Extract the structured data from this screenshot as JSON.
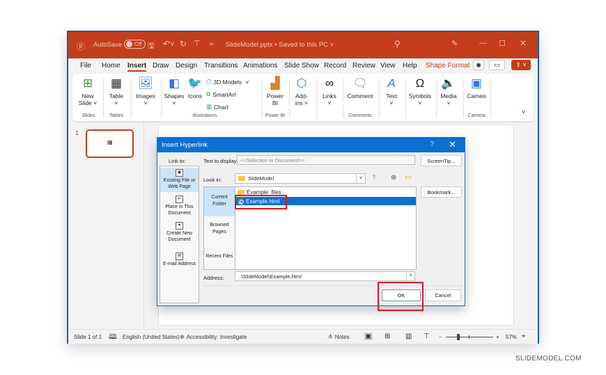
{
  "titlebar": {
    "autosave_label": "AutoSave",
    "autosave_state": "Off",
    "document_title": "SlideModel.pptx • Saved to this PC",
    "icons": [
      "powerpoint-logo-icon",
      "save-icon",
      "undo-icon",
      "redo-icon",
      "present-icon",
      "customize-qat-icon",
      "search-icon",
      "designer-icon",
      "minimize-icon",
      "maximize-icon",
      "close-icon"
    ]
  },
  "tabs": [
    {
      "label": "File"
    },
    {
      "label": "Home"
    },
    {
      "label": "Insert",
      "active": true
    },
    {
      "label": "Draw"
    },
    {
      "label": "Design"
    },
    {
      "label": "Transitions"
    },
    {
      "label": "Animations"
    },
    {
      "label": "Slide Show"
    },
    {
      "label": "Record"
    },
    {
      "label": "Review"
    },
    {
      "label": "View"
    },
    {
      "label": "Help"
    },
    {
      "label": "Shape Format"
    }
  ],
  "ribbon": {
    "new_slide": "New\nSlide",
    "new_slide_l1": "New",
    "new_slide_l2": "Slide ˅",
    "table": "Table",
    "images": "Images",
    "shapes": "Shapes",
    "icons": "Icons",
    "models_3d": "3D Models",
    "smartart": "SmartArt",
    "chart": "Chart",
    "power_bi_l1": "Power",
    "power_bi_l2": "BI",
    "addins_l1": "Add-",
    "addins_l2": "ins ˅",
    "links": "Links",
    "comment": "Comment",
    "text": "Text",
    "symbols": "Symbols",
    "media": "Media",
    "cameo": "Cameo",
    "groups": {
      "slides": "Slides",
      "tables": "Tables",
      "illustrations": "Illustrations",
      "power_bi": "Power BI",
      "comments": "Comments",
      "camera": "Camera"
    }
  },
  "thumbnail": {
    "number": "1"
  },
  "dialog": {
    "title": "Insert Hyperlink",
    "help": "?",
    "close": "✕",
    "link_to_label": "Link to:",
    "text_to_display_label": "Text to display:",
    "text_to_display_value": "<<Selection in Document>>",
    "screentip_button": "ScreenTip...",
    "look_in_label": "Look in:",
    "look_in_value": "SlideModel",
    "bookmark_button": "Bookmark...",
    "link_to_options": [
      {
        "label": "Existing File or\nWeb Page",
        "l1": "Existing File or",
        "l2": "Web Page",
        "selected": true
      },
      {
        "label": "Place in This Document",
        "l1": "Place in This",
        "l2": "Document"
      },
      {
        "label": "Create New Document",
        "l1": "Create New",
        "l2": "Document"
      },
      {
        "label": "E-mail Address",
        "l1": "E-mail Address",
        "l2": ""
      }
    ],
    "nav_options": [
      {
        "l1": "Current",
        "l2": "Folder",
        "selected": true
      },
      {
        "l1": "Browsed",
        "l2": "Pages"
      },
      {
        "l1": "Recent Files",
        "l2": ""
      }
    ],
    "files": [
      {
        "name": "Example_files",
        "type": "folder"
      },
      {
        "name": "Example.html",
        "type": "chrome-html",
        "selected": true
      }
    ],
    "address_label": "Address:",
    "address_value": "..\\SlideModel\\Example.html",
    "ok_button": "OK",
    "cancel_button": "Cancel"
  },
  "status": {
    "slide_info": "Slide 1 of 1",
    "language": "English (United States)",
    "accessibility": "Accessibility: Investigate",
    "notes": "Notes",
    "zoom_minus": "−",
    "zoom_plus": "+",
    "zoom_level": "57%",
    "zoom_fraction": 0.57
  },
  "watermark": "SLIDEMODEL.COM",
  "colors": {
    "accent": "#c43e1c",
    "dialog_blue": "#0a6fd1",
    "highlight_red": "#e8111a"
  }
}
